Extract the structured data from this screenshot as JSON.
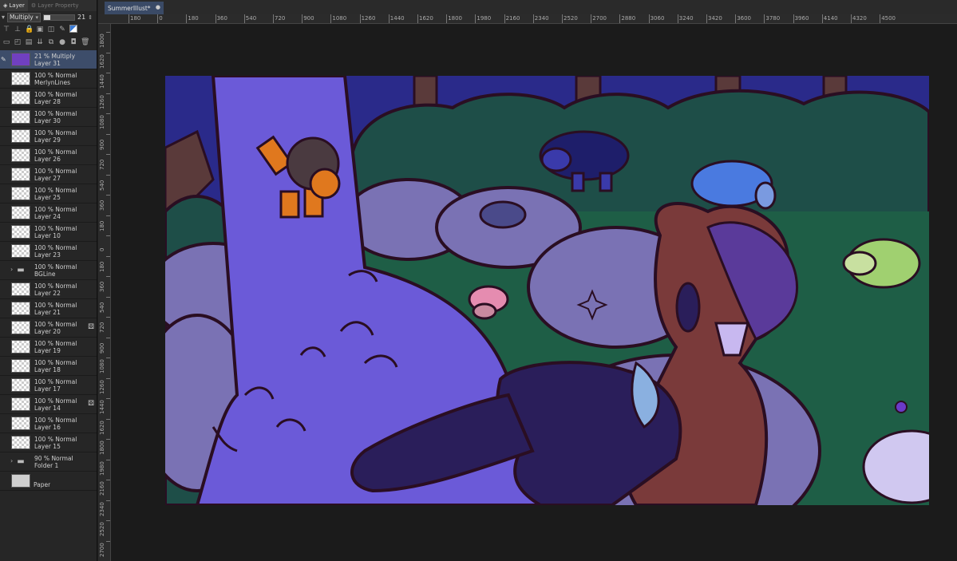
{
  "panel": {
    "tab_layer": "Layer",
    "tab_layer_property": "Layer Property",
    "blend_mode": "Multiply",
    "opacity_value": "21",
    "opacity_fraction": 0.21
  },
  "layers": [
    {
      "mode": "21 % Multiply",
      "name": "Layer 31",
      "thumb": "#7040c0",
      "selected": true
    },
    {
      "mode": "100 % Normal",
      "name": "MerlynLines"
    },
    {
      "mode": "100 % Normal",
      "name": "Layer 28"
    },
    {
      "mode": "100 % Normal",
      "name": "Layer 30"
    },
    {
      "mode": "100 % Normal",
      "name": "Layer 29"
    },
    {
      "mode": "100 % Normal",
      "name": "Layer 26"
    },
    {
      "mode": "100 % Normal",
      "name": "Layer 27"
    },
    {
      "mode": "100 % Normal",
      "name": "Layer 25"
    },
    {
      "mode": "100 % Normal",
      "name": "Layer 24"
    },
    {
      "mode": "100 % Normal",
      "name": "Layer 10"
    },
    {
      "mode": "100 % Normal",
      "name": "Layer 23"
    },
    {
      "mode": "100 % Normal",
      "name": "BGLine",
      "folder": true
    },
    {
      "mode": "100 % Normal",
      "name": "Layer 22"
    },
    {
      "mode": "100 % Normal",
      "name": "Layer 21"
    },
    {
      "mode": "100 % Normal",
      "name": "Layer 20",
      "badge": true
    },
    {
      "mode": "100 % Normal",
      "name": "Layer 19"
    },
    {
      "mode": "100 % Normal",
      "name": "Layer 18"
    },
    {
      "mode": "100 % Normal",
      "name": "Layer 17"
    },
    {
      "mode": "100 % Normal",
      "name": "Layer 14",
      "badge": true
    },
    {
      "mode": "100 % Normal",
      "name": "Layer 16"
    },
    {
      "mode": "100 % Normal",
      "name": "Layer 15"
    },
    {
      "mode": "90 % Normal",
      "name": "Folder 1",
      "folder": true
    },
    {
      "mode": "",
      "name": "Paper",
      "paper": true
    }
  ],
  "document": {
    "tab_title": "SummerIllust*",
    "close_glyph": "●"
  },
  "ruler_top": [
    "180",
    "0",
    "180",
    "360",
    "540",
    "720",
    "900",
    "1080",
    "1260",
    "1440",
    "1620",
    "1800",
    "1980",
    "2160",
    "2340",
    "2520",
    "2700",
    "2880",
    "3060",
    "3240",
    "3420",
    "3600",
    "3780",
    "3960",
    "4140",
    "4320",
    "4500"
  ],
  "ruler_left": [
    "1800",
    "1620",
    "1440",
    "1260",
    "1080",
    "900",
    "720",
    "540",
    "360",
    "180",
    "0",
    "180",
    "360",
    "540",
    "720",
    "900",
    "1080",
    "1260",
    "1440",
    "1620",
    "1800",
    "1980",
    "2160",
    "2340",
    "2520",
    "2700"
  ],
  "colors": {
    "accent_selected": "#3d4d6a",
    "sky": "#2a2a8a",
    "waterfall": "#6b5ad8",
    "rock": "#7a72b4",
    "foliage": "#1e4e48",
    "grass": "#1e5e46",
    "outline": "#2a0e22"
  }
}
